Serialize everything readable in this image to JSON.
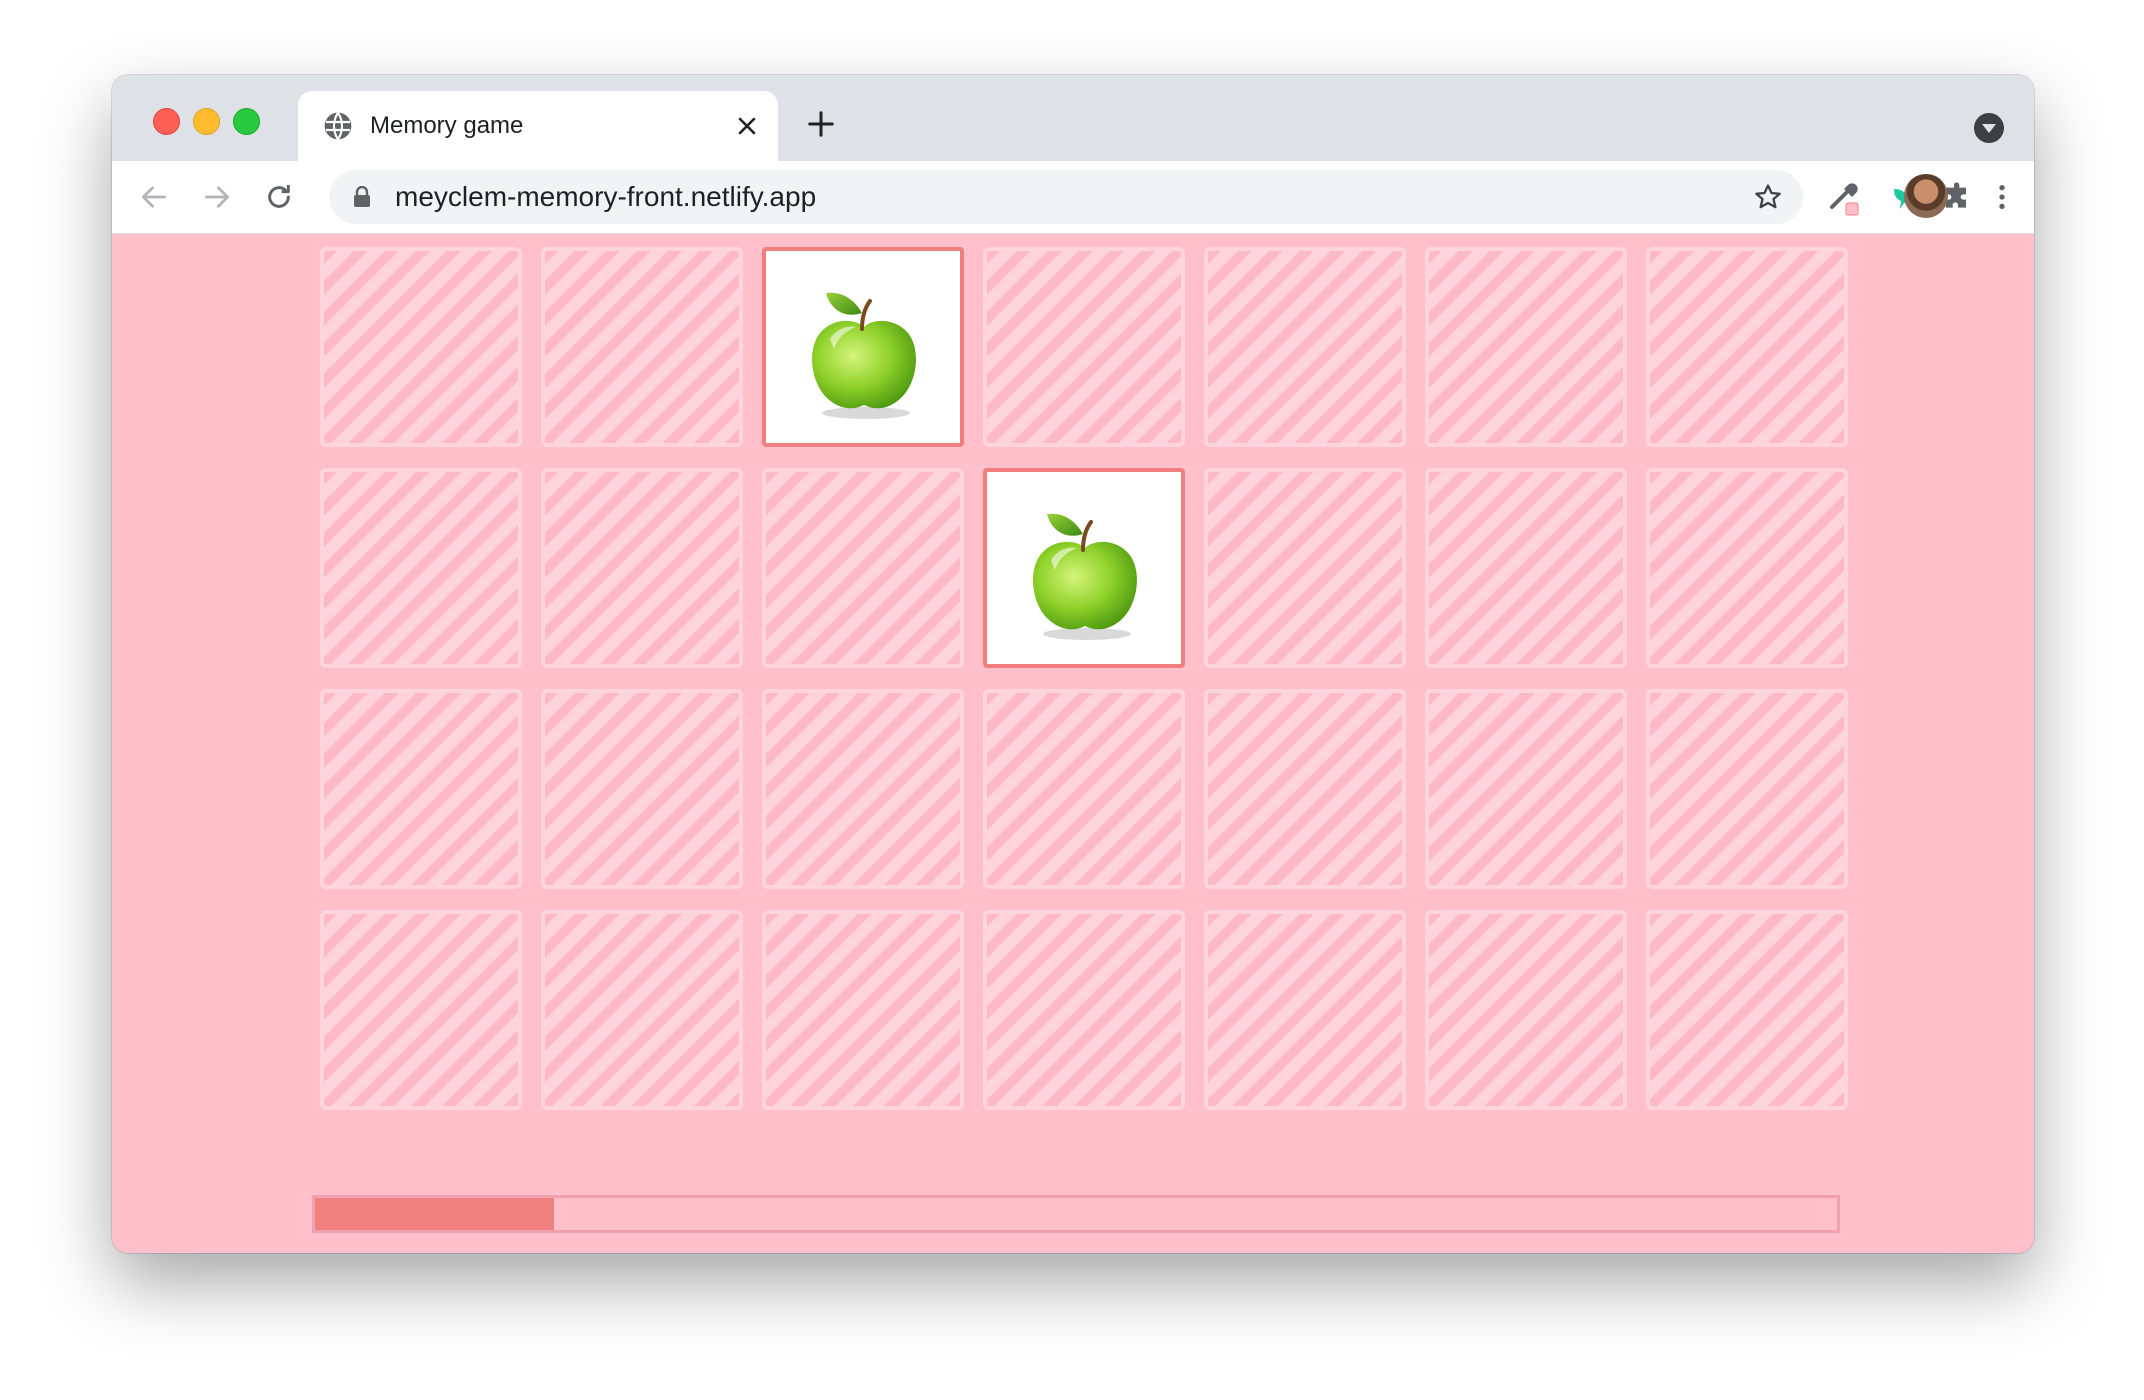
{
  "browser": {
    "tab_title": "Memory game",
    "url": "meyclem-memory-front.netlify.app",
    "icons": [
      "globe-icon",
      "close-icon",
      "plus-icon",
      "chevron-down-icon",
      "back-arrow-icon",
      "forward-arrow-icon",
      "reload-icon",
      "lock-icon",
      "star-icon",
      "eyedropper-icon",
      "extension-bird-icon",
      "puzzle-icon",
      "avatar",
      "more-vert-icon"
    ]
  },
  "game": {
    "rows": 4,
    "columns": 7,
    "revealed_cards": [
      {
        "row": 1,
        "column": 3,
        "fruit": "green-apple"
      },
      {
        "row": 2,
        "column": 4,
        "fruit": "green-apple"
      }
    ],
    "progress_fraction": 0.157
  },
  "colors": {
    "background": "#ffc0cc",
    "card_stripe_dark": "#ffb9c6",
    "card_stripe_light": "#ffd3dc",
    "revealed_border": "#f08080",
    "progress_fill": "#f08080"
  }
}
